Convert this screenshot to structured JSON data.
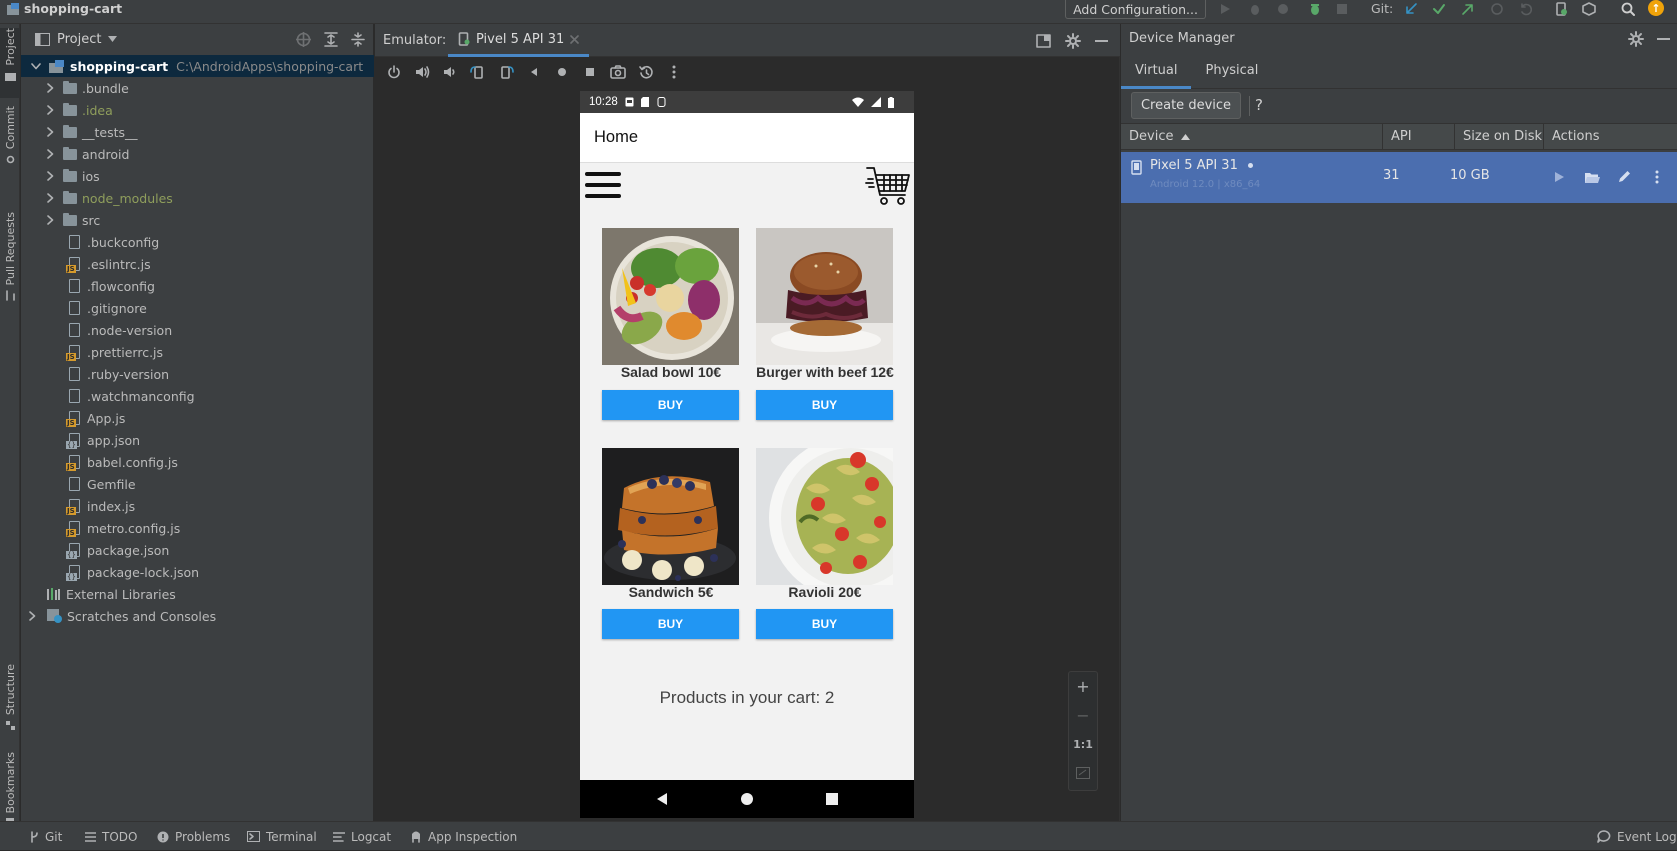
{
  "window": {
    "project_title": "shopping-cart"
  },
  "topbar": {
    "add_configuration": "Add Configuration...",
    "git_label": "Git:",
    "update_badge": "↑"
  },
  "left_strip": {
    "tabs": [
      "Project",
      "Commit",
      "Pull Requests",
      "Structure",
      "Bookmarks"
    ]
  },
  "project_panel": {
    "title": "Project",
    "root": {
      "name": "shopping-cart",
      "path": "C:\\AndroidApps\\shopping-cart"
    },
    "folders": [
      ".bundle",
      ".idea",
      "__tests__",
      "android",
      "ios",
      "node_modules",
      "src"
    ],
    "files": [
      ".buckconfig",
      ".eslintrc.js",
      ".flowconfig",
      ".gitignore",
      ".node-version",
      ".prettierrc.js",
      ".ruby-version",
      ".watchmanconfig",
      "App.js",
      "app.json",
      "babel.config.js",
      "Gemfile",
      "index.js",
      "metro.config.js",
      "package.json",
      "package-lock.json"
    ],
    "external_libraries": "External Libraries",
    "scratches": "Scratches and Consoles"
  },
  "emulator": {
    "label": "Emulator:",
    "tab": "Pivel 5 API 31",
    "zoom": {
      "plus": "+",
      "minus": "−",
      "one_to_one": "1:1"
    }
  },
  "phone": {
    "time": "10:28",
    "app_title": "Home",
    "products": [
      {
        "name": "Salad bowl 10€",
        "buy": "BUY"
      },
      {
        "name": "Burger with beef 12€",
        "buy": "BUY"
      },
      {
        "name": "Sandwich 5€",
        "buy": "BUY"
      },
      {
        "name": "Ravioli 20€",
        "buy": "BUY"
      }
    ],
    "cart_text": "Products in your cart: 2"
  },
  "device_manager": {
    "title": "Device Manager",
    "tabs": [
      "Virtual",
      "Physical"
    ],
    "create_device": "Create device",
    "help": "?",
    "columns": [
      "Device",
      "API",
      "Size on Disk",
      "Actions"
    ],
    "devices": [
      {
        "name": "Pixel 5 API 31",
        "subtitle": "Android 12.0 | x86_64",
        "api": "31",
        "size": "10 GB"
      }
    ]
  },
  "bottom_bar": {
    "left": [
      "Git",
      "TODO",
      "Problems",
      "Terminal",
      "Logcat",
      "App Inspection"
    ],
    "right": "Event Log"
  },
  "colors": {
    "selection": "#4b6eaf",
    "accent": "#4a88c7",
    "buy_button": "#2196f3",
    "tree_root": "#0d293e"
  }
}
